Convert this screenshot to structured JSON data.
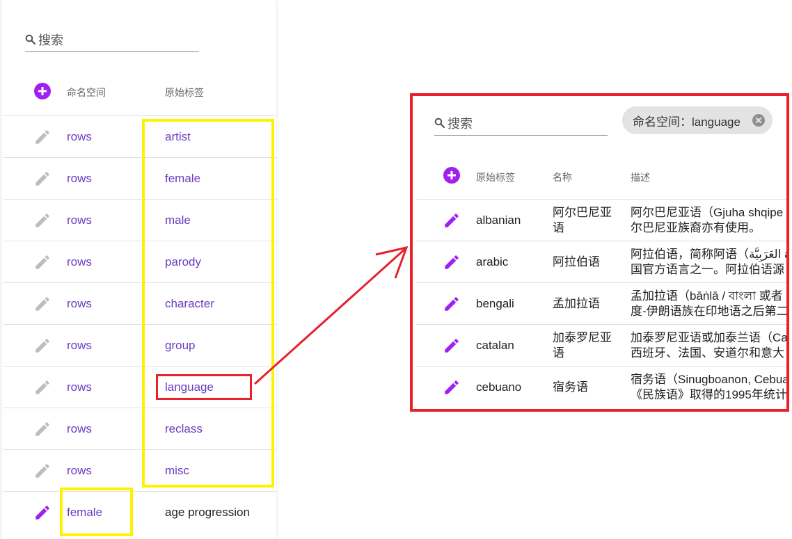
{
  "colors": {
    "accent": "#a020f0",
    "link": "#6a3bbf",
    "highlight_yellow": "#fff200",
    "highlight_red": "#e8212b"
  },
  "left": {
    "search_placeholder": "搜索",
    "header": {
      "namespace": "命名空间",
      "original_tag": "原始标签"
    },
    "rows": [
      {
        "namespace": "rows",
        "tag": "artist",
        "editable": false
      },
      {
        "namespace": "rows",
        "tag": "female",
        "editable": false
      },
      {
        "namespace": "rows",
        "tag": "male",
        "editable": false
      },
      {
        "namespace": "rows",
        "tag": "parody",
        "editable": false
      },
      {
        "namespace": "rows",
        "tag": "character",
        "editable": false
      },
      {
        "namespace": "rows",
        "tag": "group",
        "editable": false
      },
      {
        "namespace": "rows",
        "tag": "language",
        "editable": false
      },
      {
        "namespace": "rows",
        "tag": "reclass",
        "editable": false
      },
      {
        "namespace": "rows",
        "tag": "misc",
        "editable": false
      },
      {
        "namespace": "female",
        "tag": "age progression",
        "editable": true
      }
    ]
  },
  "right": {
    "search_placeholder": "搜索",
    "filter_chip": "命名空间：language",
    "header": {
      "original_tag": "原始标签",
      "name": "名称",
      "description": "描述"
    },
    "rows": [
      {
        "tag": "albanian",
        "name_line1": "阿尔巴尼亚",
        "name_line2": "语",
        "desc_line1": "阿尔巴尼亚语（Gjuha shqipe",
        "desc_line2": "尔巴尼亚族裔亦有使用。"
      },
      {
        "tag": "arabic",
        "name_line1": "阿拉伯语",
        "name_line2": "",
        "desc_line1": "阿拉伯语，简称阿语（العَرَبِيَّة a",
        "desc_line2": "国官方语言之一。阿拉伯语源"
      },
      {
        "tag": "bengali",
        "name_line1": "孟加拉语",
        "name_line2": "",
        "desc_line1": "孟加拉语（bāṅlā / বাংলা 或者",
        "desc_line2": "度-伊朗语族在印地语之后第二"
      },
      {
        "tag": "catalan",
        "name_line1": "加泰罗尼亚",
        "name_line2": "语",
        "desc_line1": "加泰罗尼亚语或加泰兰语（Ca",
        "desc_line2": "西班牙、法国、安道尔和意大"
      },
      {
        "tag": "cebuano",
        "name_line1": "宿务语",
        "name_line2": "",
        "desc_line1": "宿务语（Sinugboanon, Cebua",
        "desc_line2": "《民族语》取得的1995年统计"
      }
    ]
  }
}
